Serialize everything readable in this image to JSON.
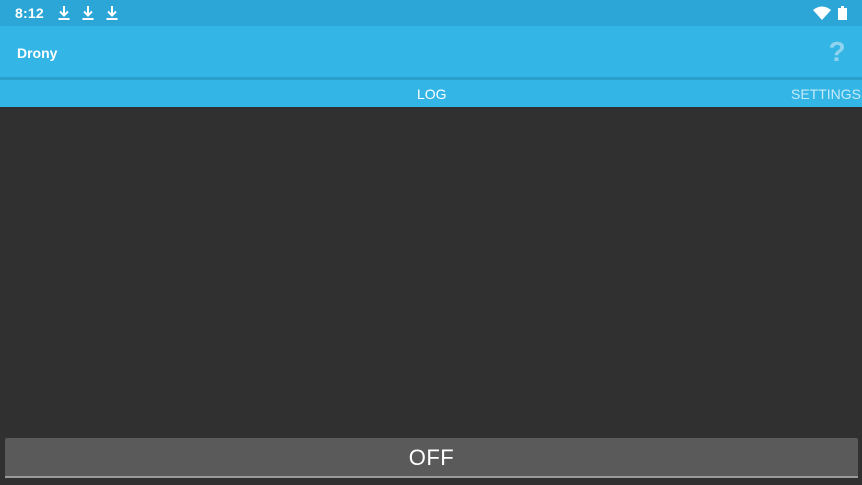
{
  "status_bar": {
    "time": "8:12",
    "notification_icons": [
      "download-icon",
      "download-icon",
      "download-icon"
    ],
    "right_icons": [
      "wifi-icon",
      "battery-icon"
    ]
  },
  "app_bar": {
    "title": "Drony",
    "help_icon": "?"
  },
  "tabs": [
    {
      "label": "LOG",
      "active": true
    },
    {
      "label": "SETTINGS",
      "active": false
    }
  ],
  "log": {
    "entries": []
  },
  "toggle": {
    "label": "OFF"
  },
  "colors": {
    "status_bar": "#2ca6d6",
    "app_bar": "#33b5e5",
    "background": "#303030",
    "button": "#5a5a5b"
  }
}
